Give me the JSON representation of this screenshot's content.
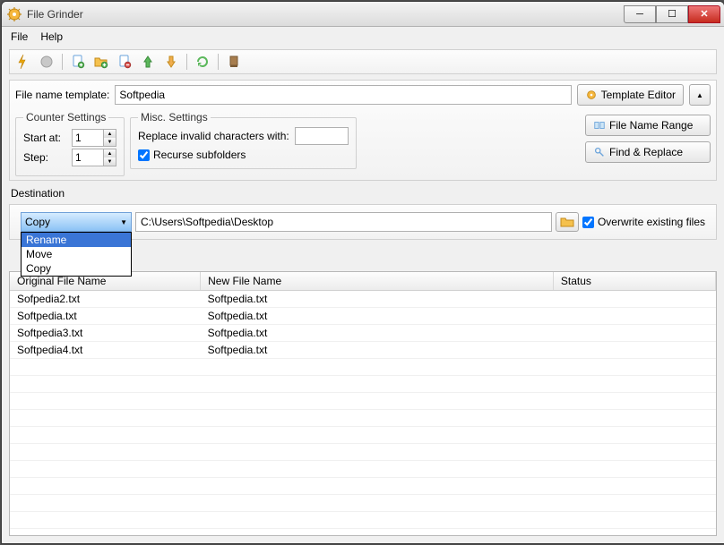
{
  "window": {
    "title": "File Grinder"
  },
  "menu": {
    "file": "File",
    "help": "Help"
  },
  "template": {
    "label": "File name template:",
    "value": "Softpedia",
    "editor_btn": "Template Editor"
  },
  "counter": {
    "legend": "Counter Settings",
    "start_label": "Start at:",
    "start_value": "1",
    "step_label": "Step:",
    "step_value": "1"
  },
  "misc": {
    "legend": "Misc. Settings",
    "replace_label": "Replace invalid characters with:",
    "replace_value": "",
    "recurse_label": "Recurse subfolders"
  },
  "buttons": {
    "file_name_range": "File Name Range",
    "find_replace": "Find & Replace"
  },
  "destination": {
    "label": "Destination",
    "selected": "Copy",
    "options": [
      "Rename",
      "Move",
      "Copy"
    ],
    "path": "C:\\Users\\Softpedia\\Desktop",
    "overwrite_label": "Overwrite existing files"
  },
  "table": {
    "headers": {
      "original": "Original File Name",
      "new": "New File Name",
      "status": "Status"
    },
    "rows": [
      {
        "original": "Sofpedia2.txt",
        "new": "Softpedia.txt",
        "status": ""
      },
      {
        "original": "Softpedia.txt",
        "new": "Softpedia.txt",
        "status": ""
      },
      {
        "original": "Softpedia3.txt",
        "new": "Softpedia.txt",
        "status": ""
      },
      {
        "original": "Softpedia4.txt",
        "new": "Softpedia.txt",
        "status": ""
      }
    ]
  }
}
